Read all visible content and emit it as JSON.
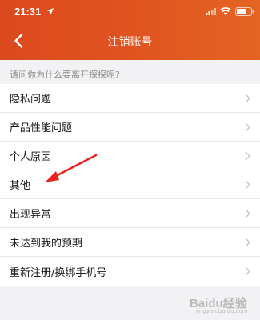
{
  "status_bar": {
    "time": "21:31",
    "icons": [
      "location-arrow-icon",
      "signal-icon",
      "wifi-icon",
      "battery-icon"
    ]
  },
  "nav": {
    "title": "注销账号",
    "back_icon": "chevron-left-icon"
  },
  "section_hint": "请问你为什么要离开探探呢?",
  "reasons": [
    {
      "label": "隐私问题"
    },
    {
      "label": "产品性能问题"
    },
    {
      "label": "个人原因"
    },
    {
      "label": "其他"
    },
    {
      "label": "出现异常"
    },
    {
      "label": "未达到我的预期"
    },
    {
      "label": "重新注册/换绑手机号"
    }
  ],
  "watermark": {
    "text": "Baidu经验",
    "sub": "jingyan.baidu.com"
  },
  "colors": {
    "header_start": "#dc4a1f",
    "header_end": "#e46423",
    "page_bg": "#f2f2f4",
    "annotation": "#e8221c"
  }
}
